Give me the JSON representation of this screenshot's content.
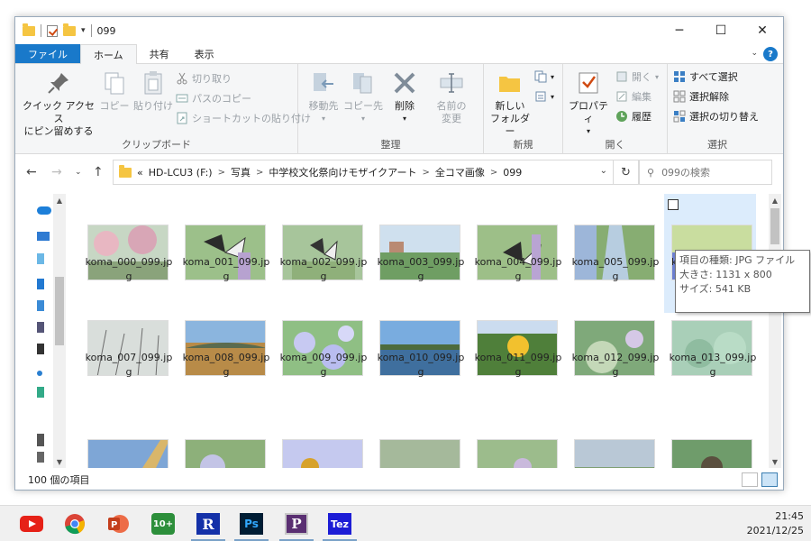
{
  "titlebar": {
    "title": "099"
  },
  "tabs": {
    "file": "ファイル",
    "home": "ホーム",
    "share": "共有",
    "view": "表示"
  },
  "ribbon": {
    "clipboard": {
      "label": "クリップボード",
      "pin_line1": "クイック アクセス",
      "pin_line2": "にピン留めする",
      "copy": "コピー",
      "paste": "貼り付け",
      "cut": "切り取り",
      "copy_path": "パスのコピー",
      "paste_shortcut": "ショートカットの貼り付け"
    },
    "organize": {
      "label": "整理",
      "move_to": "移動先",
      "copy_to": "コピー先",
      "delete": "削除",
      "rename_line1": "名前の",
      "rename_line2": "変更"
    },
    "new": {
      "label": "新規",
      "new_folder_line1": "新しい",
      "new_folder_line2": "フォルダー"
    },
    "open": {
      "label": "開く",
      "properties": "プロパティ",
      "open": "開く",
      "edit": "編集",
      "history": "履歴"
    },
    "select": {
      "label": "選択",
      "select_all": "すべて選択",
      "select_none": "選択解除",
      "invert": "選択の切り替え"
    }
  },
  "address": {
    "prefix": "«",
    "crumbs": [
      "HD-LCU3 (F:)",
      "写真",
      "中学校文化祭向けモザイクアート",
      "全コマ画像",
      "099"
    ],
    "search_placeholder": "099の検索"
  },
  "files": [
    {
      "name1": "koma_000_099.jp",
      "name2": "g"
    },
    {
      "name1": "koma_001_099.jp",
      "name2": "g"
    },
    {
      "name1": "koma_002_099.jp",
      "name2": "g"
    },
    {
      "name1": "koma_003_099.jp",
      "name2": "g"
    },
    {
      "name1": "koma_004_099.jp",
      "name2": "g"
    },
    {
      "name1": "koma_005_099.jp",
      "name2": "g"
    },
    {
      "name1": "ko",
      "name2": ""
    },
    {
      "name1": "koma_007_099.jp",
      "name2": "g"
    },
    {
      "name1": "koma_008_099.jp",
      "name2": "g"
    },
    {
      "name1": "koma_009_099.jp",
      "name2": "g"
    },
    {
      "name1": "koma_010_099.jp",
      "name2": "g"
    },
    {
      "name1": "koma_011_099.jp",
      "name2": "g"
    },
    {
      "name1": "koma_012_099.jp",
      "name2": "g"
    },
    {
      "name1": "koma_013_099.jp",
      "name2": "g"
    }
  ],
  "tooltip": {
    "type": "項目の種類: JPG ファイル",
    "dimensions": "大きさ: 1131 x 800",
    "size": "サイズ: 541 KB"
  },
  "status": {
    "count": "100 個の項目"
  },
  "taskbar": {
    "icons": [
      "youtube-icon",
      "chrome-icon",
      "powerpoint-icon",
      "tenplus-icon",
      "r-app-icon",
      "photoshop-icon",
      "p-app-icon",
      "tez-app-icon"
    ],
    "r_label": "R",
    "ps_label": "Ps",
    "p_label": "P",
    "tez_label": "Tez",
    "tenplus_label": "10+",
    "time": "21:45",
    "date": "2021/12/25"
  },
  "colors": {
    "accent": "#1979ca",
    "selection": "#dcecfc"
  }
}
